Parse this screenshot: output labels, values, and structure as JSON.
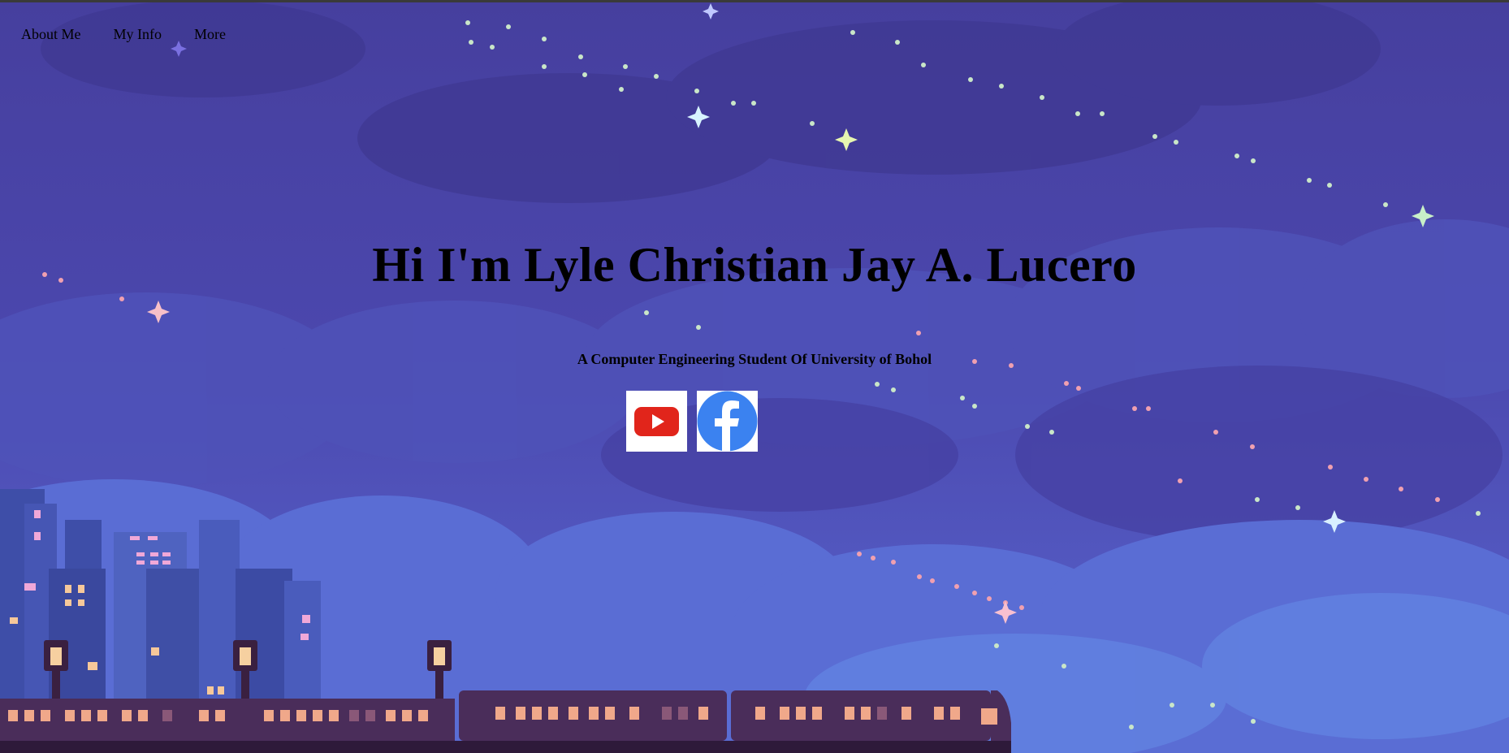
{
  "nav": {
    "items": [
      {
        "label": "About Me"
      },
      {
        "label": "My Info"
      },
      {
        "label": "More"
      }
    ]
  },
  "hero": {
    "title": "Hi I'm Lyle Christian Jay A. Lucero",
    "subtitle": "A Computer Engineering Student Of University of Bohol"
  },
  "social": {
    "youtube_icon": "youtube-icon",
    "facebook_icon": "facebook-icon"
  },
  "colors": {
    "sky_top": "#463f9e",
    "sky_mid": "#5350b8",
    "sky_low": "#5b6fd6",
    "train": "#4a2d5a",
    "window_light": "#f0a88a",
    "youtube_red": "#e1251b",
    "facebook_blue": "#3b82f0"
  }
}
